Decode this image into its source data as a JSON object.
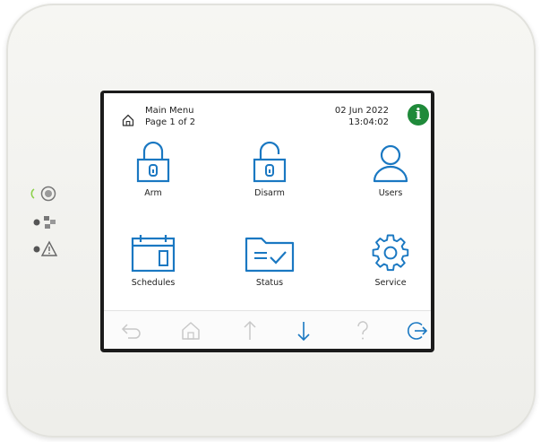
{
  "header": {
    "title": "Main Menu",
    "page": "Page 1 of 2",
    "date": "02 Jun 2022",
    "time": "13:04:02"
  },
  "tiles": [
    {
      "label": "Arm",
      "icon": "locked-padlock-icon"
    },
    {
      "label": "Disarm",
      "icon": "unlocked-padlock-icon"
    },
    {
      "label": "Users",
      "icon": "user-icon"
    },
    {
      "label": "Schedules",
      "icon": "calendar-icon"
    },
    {
      "label": "Status",
      "icon": "folder-check-icon"
    },
    {
      "label": "Service",
      "icon": "gear-icon"
    }
  ],
  "navbar": [
    "back-arrow-icon",
    "home-icon",
    "up-arrow-icon",
    "down-arrow-icon",
    "help-icon",
    "logout-icon"
  ],
  "colors": {
    "accent": "#1a78c2",
    "info": "#1f8a3a",
    "nav_disabled": "#c8c8c8",
    "power_led": "#8bd14a"
  }
}
